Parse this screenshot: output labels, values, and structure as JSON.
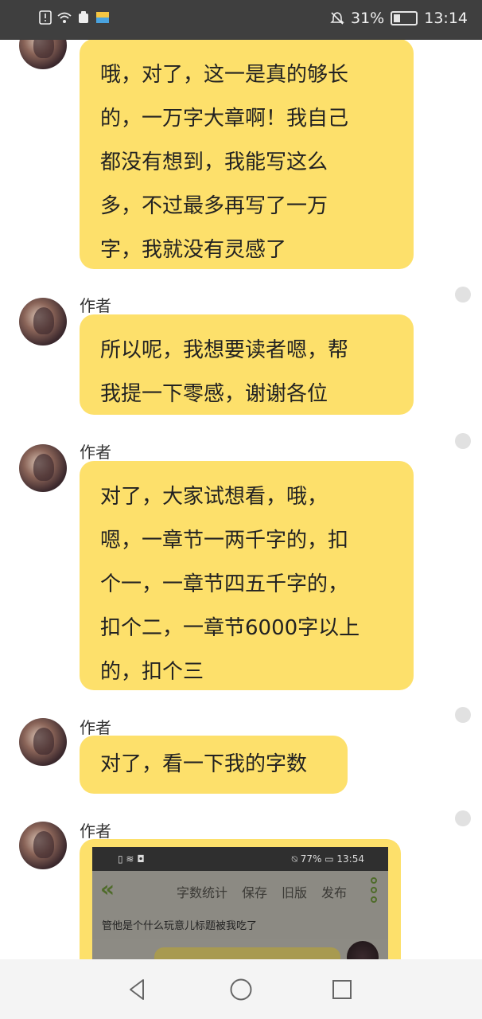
{
  "status_bar": {
    "left_icons": [
      "alert-icon",
      "wifi-icon",
      "notification-icon",
      "app-icon"
    ],
    "battery_percent": "31%",
    "battery_level": 0.31,
    "time": "13:14"
  },
  "messages": [
    {
      "sender": "",
      "lines": [
        "哦，对了，这一是真的够长",
        "的，一万字大章啊！我自己",
        "都没有想到，我能写这么",
        "多，不过最多再写了一万",
        "字，我就没有灵感了"
      ]
    },
    {
      "sender": "作者",
      "lines": [
        "所以呢，我想要读者嗯，帮",
        "我提一下零感，谢谢各位"
      ]
    },
    {
      "sender": "作者",
      "lines": [
        "对了，大家试想看，哦，",
        "嗯，一章节一两千字的，扣",
        "个一，一章节四五千字的，",
        "扣个二，一章节6000字以上",
        "的，扣个三"
      ]
    },
    {
      "sender": "作者",
      "lines": [
        "对了，看一下我的字数"
      ]
    },
    {
      "sender": "作者",
      "screenshot": {
        "battery": "77%",
        "time": "13:54",
        "menu": [
          "字数统计",
          "保存",
          "旧版",
          "发布"
        ],
        "title": "管他是个什么玩意儿标题被我吃了"
      }
    }
  ],
  "nav": {
    "back": "back-icon",
    "home": "home-icon",
    "recents": "recents-icon"
  }
}
